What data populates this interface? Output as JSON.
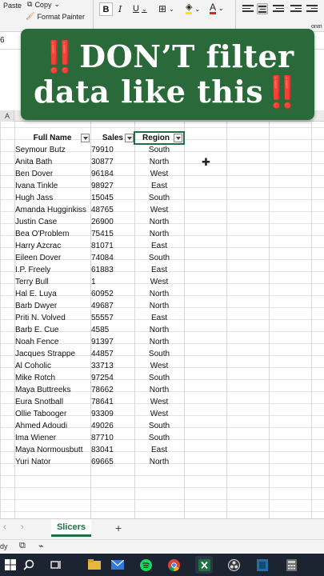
{
  "ribbon": {
    "paste_label": "Paste",
    "copy_label": "Copy",
    "format_painter_label": "Format Painter",
    "bold": "B",
    "italic": "I",
    "underline": "U",
    "font_color_letter": "A",
    "wrap_fragment": "onm"
  },
  "namebox": {
    "value": "6"
  },
  "banner": {
    "line1": "DON’T filter",
    "line2": "data like this",
    "mark": "‼️"
  },
  "column_header": {
    "visible_letter": "A"
  },
  "table": {
    "headers": [
      "Full Name",
      "Sales",
      "Region"
    ],
    "rows": [
      [
        "Seymour Butz",
        "79910",
        "South"
      ],
      [
        "Anita Bath",
        "30877",
        "North"
      ],
      [
        "Ben Dover",
        "96184",
        "West"
      ],
      [
        "Ivana Tinkle",
        "98927",
        "East"
      ],
      [
        "Hugh Jass",
        "15045",
        "South"
      ],
      [
        "Amanda Hugginkiss",
        "48765",
        "West"
      ],
      [
        "Justin Case",
        "26900",
        "North"
      ],
      [
        "Bea O'Problem",
        "75415",
        "North"
      ],
      [
        "Harry Azcrac",
        "81071",
        "East"
      ],
      [
        "Eileen Dover",
        "74084",
        "South"
      ],
      [
        "I.P. Freely",
        "61883",
        "East"
      ],
      [
        "Terry Bull",
        "1",
        "West"
      ],
      [
        "Hal E. Luya",
        "60952",
        "North"
      ],
      [
        "Barb Dwyer",
        "49687",
        "North"
      ],
      [
        "Priti N. Volved",
        "55557",
        "East"
      ],
      [
        "Barb E. Cue",
        "4585",
        "North"
      ],
      [
        "Noah Fence",
        "91397",
        "North"
      ],
      [
        "Jacques Strappe",
        "44857",
        "South"
      ],
      [
        "Al Coholic",
        "33713",
        "West"
      ],
      [
        "Mike Rotch",
        "97254",
        "South"
      ],
      [
        "Maya Buttreeks",
        "78662",
        "North"
      ],
      [
        "Eura Snotball",
        "78641",
        "West"
      ],
      [
        "Ollie Tabooger",
        "93309",
        "West"
      ],
      [
        "Ahmed Adoudi",
        "49026",
        "South"
      ],
      [
        "Ima Wiener",
        "87710",
        "South"
      ],
      [
        "Maya Normousbutt",
        "83041",
        "East"
      ],
      [
        "Yuri Nator",
        "69665",
        "North"
      ]
    ]
  },
  "sheets": {
    "active": "Slicers",
    "add_label": "+"
  },
  "status": {
    "text": "dy"
  },
  "colors": {
    "banner_bg": "#2a6a3a",
    "excel_green": "#1f7144",
    "alarm_red": "#e22222"
  },
  "taskbar_icons": [
    "windows-icon",
    "search-icon",
    "task-view-icon",
    "file-explorer-icon",
    "mail-icon",
    "spotify-icon",
    "chrome-icon",
    "excel-icon",
    "obs-icon",
    "app-icon",
    "calculator-icon"
  ]
}
